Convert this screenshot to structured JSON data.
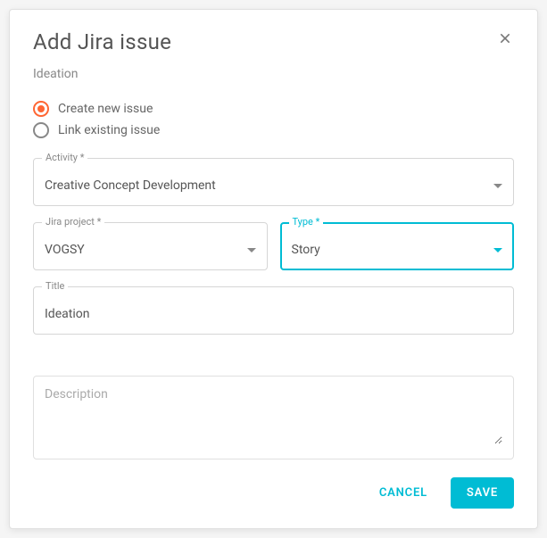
{
  "dialog": {
    "title": "Add Jira issue",
    "subtitle": "Ideation"
  },
  "radios": {
    "create": {
      "label": "Create new issue",
      "selected": true
    },
    "link": {
      "label": "Link existing issue",
      "selected": false
    }
  },
  "fields": {
    "activity": {
      "label": "Activity *",
      "value": "Creative Concept Development"
    },
    "project": {
      "label": "Jira project *",
      "value": "VOGSY"
    },
    "type": {
      "label": "Type *",
      "value": "Story"
    },
    "title": {
      "label": "Title",
      "value": "Ideation"
    },
    "description": {
      "placeholder": "Description",
      "value": ""
    }
  },
  "actions": {
    "cancel": "CANCEL",
    "save": "SAVE"
  },
  "colors": {
    "accent_teal": "#00bcd4",
    "accent_orange": "#ff6633"
  }
}
